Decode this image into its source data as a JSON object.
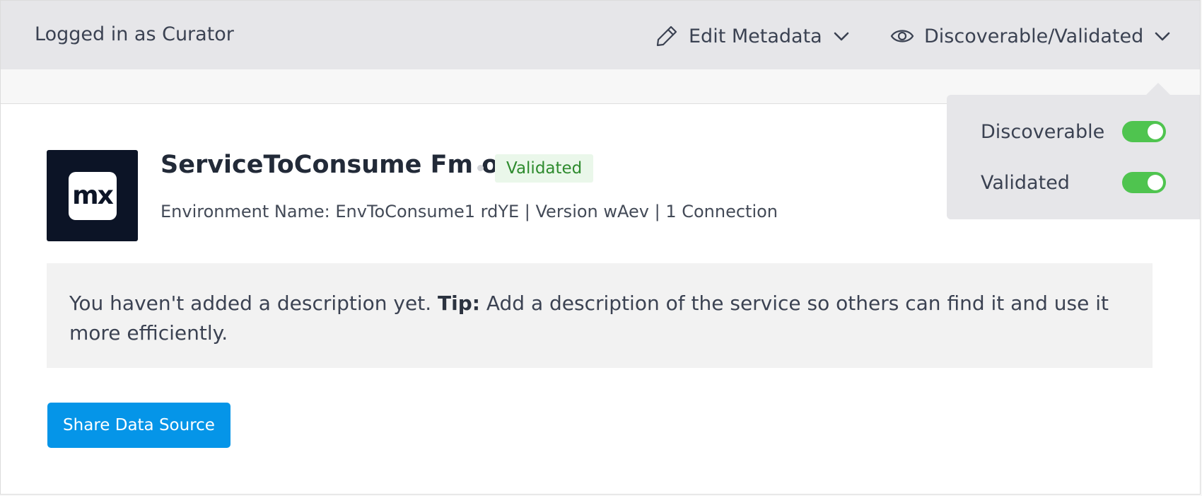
{
  "header": {
    "login_text": "Logged in as Curator",
    "edit_metadata_label": "Edit Metadata",
    "visibility_label": "Discoverable/Validated"
  },
  "service": {
    "logo_text": "mx",
    "title": "ServiceToConsume Fm o",
    "status_badge": "Validated",
    "meta": "Environment Name: EnvToConsume1 rdYE | Version wAev | 1 Connection"
  },
  "description": {
    "text": "You haven't added a description yet.",
    "tip_label": "Tip:",
    "tip_text": "Add a description of the service so others can find it and use it more efficiently."
  },
  "actions": {
    "share_label": "Share Data Source"
  },
  "visibility_menu": {
    "discoverable_label": "Discoverable",
    "discoverable_on": true,
    "validated_label": "Validated",
    "validated_on": true
  },
  "colors": {
    "accent": "#0595e8",
    "toggle_on": "#4fc44f",
    "badge_text": "#2e8b2e",
    "badge_bg": "#eaf7ea"
  },
  "icons": {
    "edit": "pencil-icon",
    "visibility": "eye-icon",
    "chevron": "chevron-down-icon"
  }
}
